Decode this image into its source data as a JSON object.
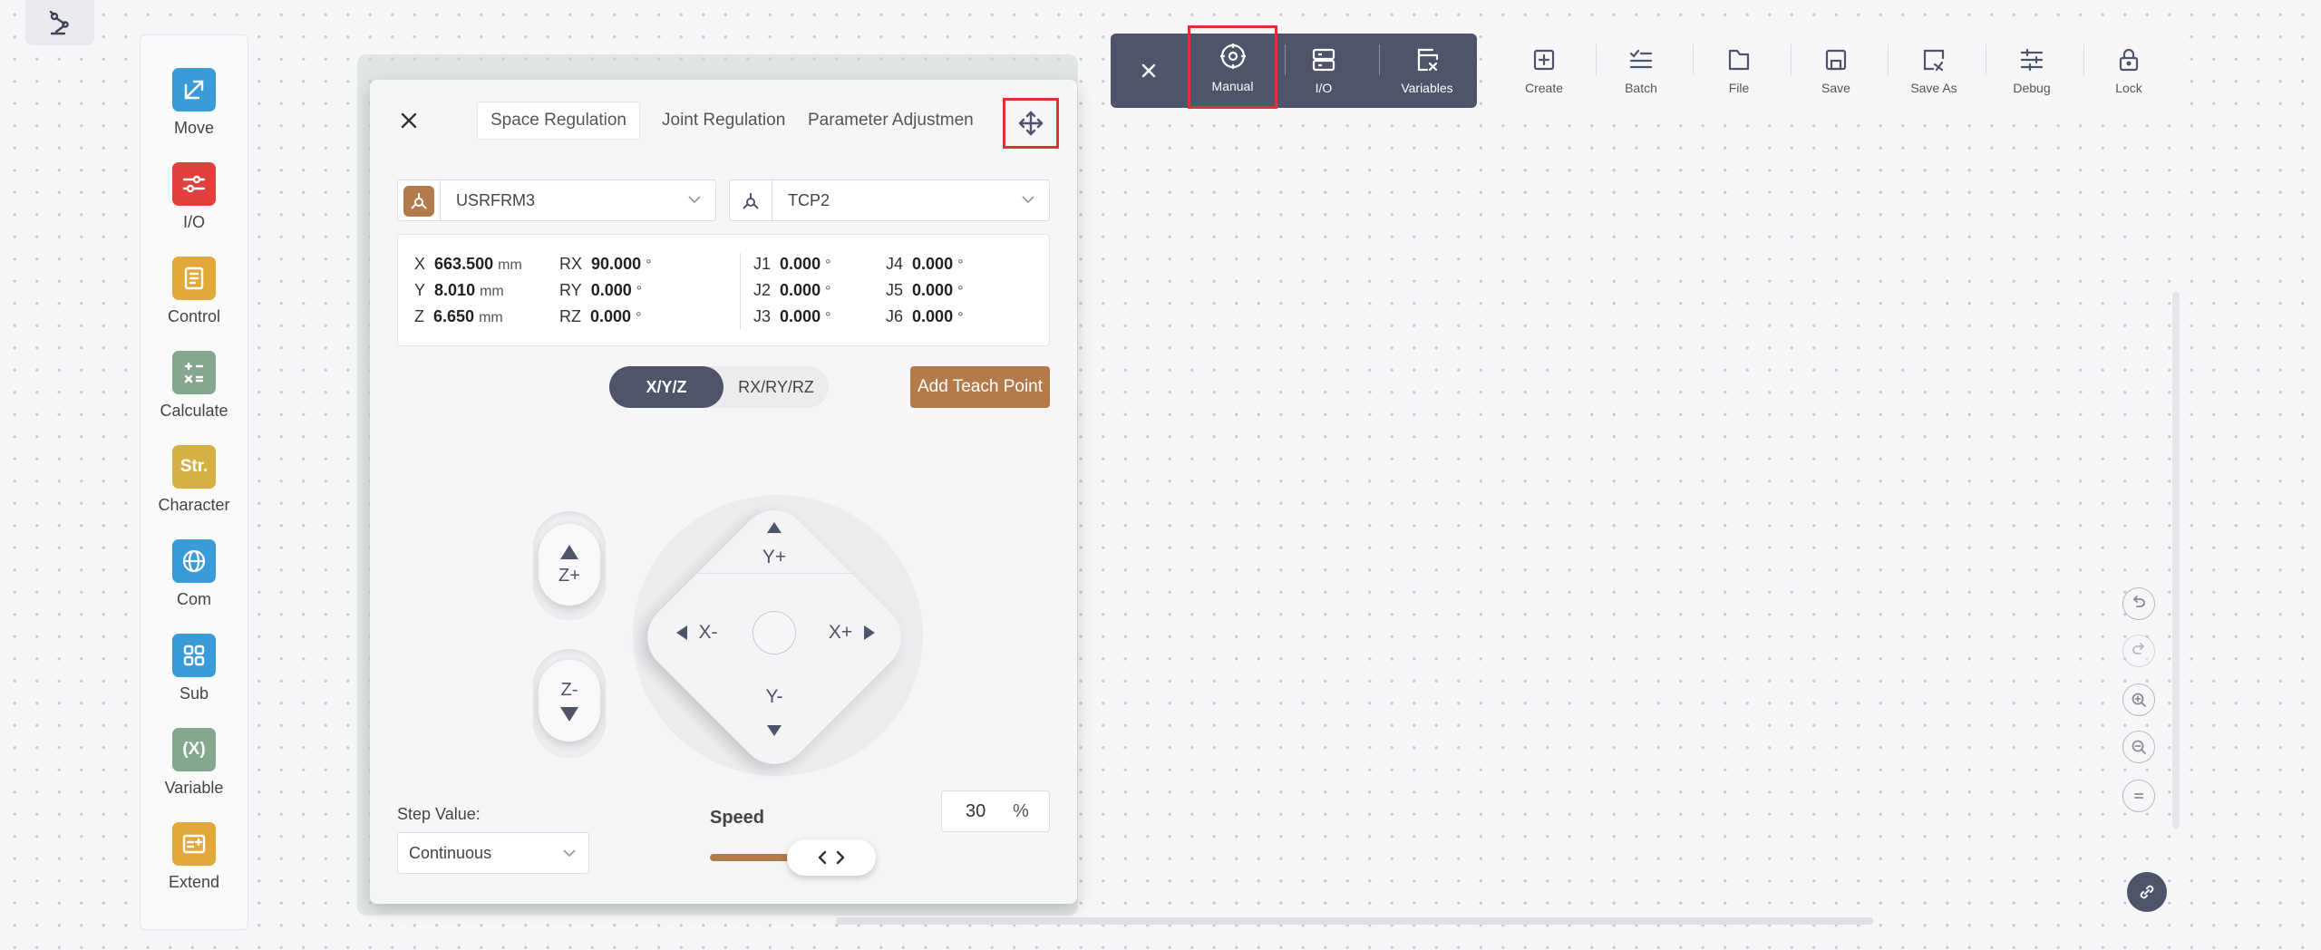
{
  "palette": {
    "items": [
      {
        "label": "Move",
        "icon": "move-icon",
        "color": "#3a9bd9"
      },
      {
        "label": "I/O",
        "icon": "io-icon",
        "color": "#e2403c"
      },
      {
        "label": "Control",
        "icon": "control-icon",
        "color": "#e2a93a"
      },
      {
        "label": "Calculate",
        "icon": "calculate-icon",
        "color": "#86a78f"
      },
      {
        "label": "Character",
        "icon": "character-icon",
        "color": "#d6b045",
        "glyph": "Str."
      },
      {
        "label": "Com",
        "icon": "globe-icon",
        "color": "#3a9bd9"
      },
      {
        "label": "Sub",
        "icon": "grid-icon",
        "color": "#3a9bd9"
      },
      {
        "label": "Variable",
        "icon": "variable-icon",
        "color": "#86a78f",
        "glyph": "(X)"
      },
      {
        "label": "Extend",
        "icon": "extend-icon",
        "color": "#e2a93a"
      }
    ]
  },
  "dark_toolbar": {
    "manual_label": "Manual",
    "io_label": "I/O",
    "variables_label": "Variables"
  },
  "light_toolbar": {
    "items": [
      "Create",
      "Batch",
      "File",
      "Save",
      "Save As",
      "Debug",
      "Lock"
    ]
  },
  "panel": {
    "tabs": [
      "Space Regulation",
      "Joint Regulation",
      "Parameter Adjustmen"
    ],
    "frame_select": "USRFRM3",
    "tool_select": "TCP2",
    "coords": {
      "x": {
        "label": "X",
        "value": "663.500",
        "unit": "mm"
      },
      "y": {
        "label": "Y",
        "value": "8.010",
        "unit": "mm"
      },
      "z": {
        "label": "Z",
        "value": "6.650",
        "unit": "mm"
      },
      "rx": {
        "label": "RX",
        "value": "90.000",
        "unit": "°"
      },
      "ry": {
        "label": "RY",
        "value": "0.000",
        "unit": "°"
      },
      "rz": {
        "label": "RZ",
        "value": "0.000",
        "unit": "°"
      },
      "j1": {
        "label": "J1",
        "value": "0.000",
        "unit": "°"
      },
      "j2": {
        "label": "J2",
        "value": "0.000",
        "unit": "°"
      },
      "j3": {
        "label": "J3",
        "value": "0.000",
        "unit": "°"
      },
      "j4": {
        "label": "J4",
        "value": "0.000",
        "unit": "°"
      },
      "j5": {
        "label": "J5",
        "value": "0.000",
        "unit": "°"
      },
      "j6": {
        "label": "J6",
        "value": "0.000",
        "unit": "°"
      }
    },
    "mode_active": "X/Y/Z",
    "mode_inactive": "RX/RY/RZ",
    "add_teach_point": "Add Teach Point",
    "jog": {
      "z_plus": "Z+",
      "z_minus": "Z-",
      "y_plus": "Y+",
      "y_minus": "Y-",
      "x_plus": "X+",
      "x_minus": "X-"
    },
    "step_label": "Step Value:",
    "step_value": "Continuous",
    "speed_label": "Speed",
    "speed_value": "30",
    "speed_unit": "%",
    "speed_fraction": 0.3
  },
  "colors": {
    "accent_dark": "#4e5469",
    "accent_brown": "#b37a4c",
    "highlight_red": "#e03232"
  }
}
